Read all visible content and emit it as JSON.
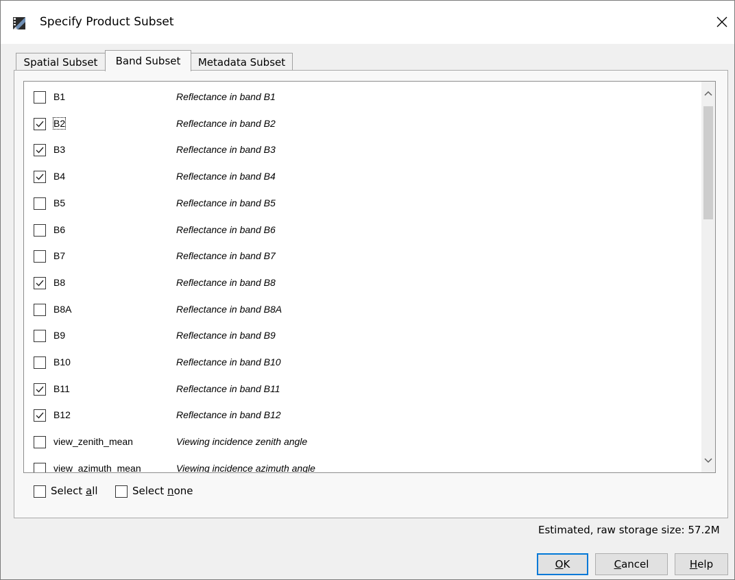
{
  "window": {
    "title": "Specify Product Subset",
    "close_glyph": "✕"
  },
  "tabs": [
    {
      "label": "Spatial Subset",
      "active": false
    },
    {
      "label": "Band Subset",
      "active": true
    },
    {
      "label": "Metadata Subset",
      "active": false
    }
  ],
  "bands": [
    {
      "name": "B1",
      "description": "Reflectance in band B1",
      "checked": false
    },
    {
      "name": "B2",
      "description": "Reflectance in band B2",
      "checked": true
    },
    {
      "name": "B3",
      "description": "Reflectance in band B3",
      "checked": true
    },
    {
      "name": "B4",
      "description": "Reflectance in band B4",
      "checked": true
    },
    {
      "name": "B5",
      "description": "Reflectance in band B5",
      "checked": false
    },
    {
      "name": "B6",
      "description": "Reflectance in band B6",
      "checked": false
    },
    {
      "name": "B7",
      "description": "Reflectance in band B7",
      "checked": false
    },
    {
      "name": "B8",
      "description": "Reflectance in band B8",
      "checked": true
    },
    {
      "name": "B8A",
      "description": "Reflectance in band B8A",
      "checked": false
    },
    {
      "name": "B9",
      "description": "Reflectance in band B9",
      "checked": false
    },
    {
      "name": "B10",
      "description": "Reflectance in band B10",
      "checked": false
    },
    {
      "name": "B11",
      "description": "Reflectance in band B11",
      "checked": true
    },
    {
      "name": "B12",
      "description": "Reflectance in band B12",
      "checked": true
    },
    {
      "name": "view_zenith_mean",
      "description": "Viewing incidence zenith angle",
      "checked": false
    },
    {
      "name": "view_azimuth_mean",
      "description": "Viewing incidence azimuth angle",
      "checked": false
    }
  ],
  "selection": {
    "select_all_prefix": "Select ",
    "select_all_mnemonic": "a",
    "select_all_suffix": "ll",
    "select_none_prefix": "Select ",
    "select_none_mnemonic": "n",
    "select_none_suffix": "one"
  },
  "storage": {
    "text": "Estimated, raw storage size: 57.2M"
  },
  "buttons": {
    "ok_mnemonic": "O",
    "ok_rest": "K",
    "cancel_mnemonic": "C",
    "cancel_rest": "ancel",
    "help_mnemonic": "H",
    "help_rest": "elp"
  },
  "colors": {
    "focus_border": "#0078d7",
    "thumb": "#cdcdcd"
  }
}
